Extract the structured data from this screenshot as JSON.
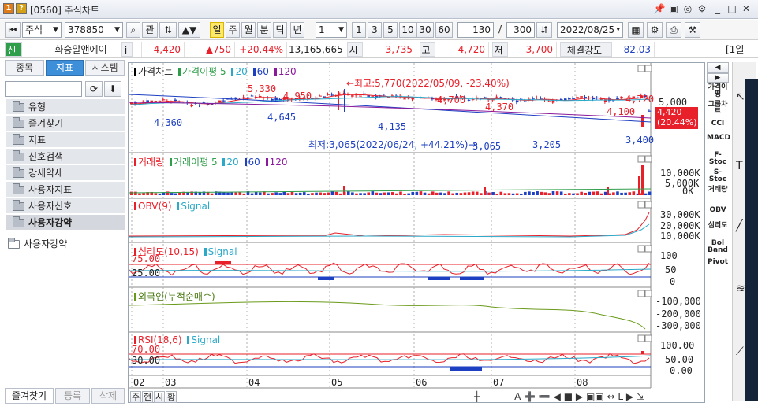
{
  "window": {
    "badge_1": "1",
    "badge_help": "?",
    "title": "[0560] 주식차트"
  },
  "toolbar": {
    "market": "주식",
    "code": "378850",
    "btn_gwan": "관",
    "periods": [
      "일",
      "주",
      "월",
      "분",
      "틱",
      "년"
    ],
    "selected_period": "일",
    "count_select": "1",
    "quick": [
      "1",
      "3",
      "5",
      "10",
      "30",
      "60"
    ],
    "view_count": "130",
    "total_count": "300",
    "date": "2022/08/25"
  },
  "quote": {
    "tag": "신",
    "info": "i",
    "name": "화승알앤에이",
    "price": "4,420",
    "change": "▲750",
    "pct": "+20.44%",
    "volume": "13,165,665",
    "open_label": "시",
    "open": "3,735",
    "high_label": "고",
    "high": "4,720",
    "low_label": "저",
    "low": "3,700",
    "strength_label": "체결강도",
    "strength": "82.03",
    "extra": "[1일"
  },
  "left": {
    "tabs": [
      "종목",
      "지표",
      "시스템"
    ],
    "selected_tab": "지표",
    "search_placeholder": "",
    "items": [
      "유형",
      "즐겨찾기",
      "지표",
      "신호검색",
      "강세약세",
      "사용자지표",
      "사용자신호",
      "사용자강약"
    ],
    "sub_item": "사용자강약",
    "bottom_tabs": [
      "즐겨찾기",
      "등록",
      "삭제"
    ]
  },
  "chart": {
    "price_title": "가격차트",
    "ma_title": "가격이평",
    "ma_periods": [
      "5",
      "20",
      "60",
      "120"
    ],
    "vol_title": "거래량",
    "vol_ma_title": "거래이평",
    "obv_title": "OBV(9)",
    "signal": "Signal",
    "psy_title": "심리도(10,15)",
    "foreign_title": "외국인(누적순매수)",
    "rsi_title": "RSI(18,6)",
    "annotations": {
      "high_note": "←최고:5,770(2022/05/09, -23.40%)",
      "low_note": "최저:3,065(2022/06/24, +44.21%)→",
      "labels": [
        "5,330",
        "4,950",
        "4,360",
        "4,645",
        "4,135",
        "4,700",
        "4,370",
        "3,065",
        "3,205",
        "4,100",
        "4,720",
        "3,400"
      ]
    },
    "price_axis": "5,000",
    "last_price": "4,420",
    "last_pct": "(20.44%)",
    "vol_axis": [
      "10,000K",
      "5,000K",
      "0K"
    ],
    "obv_axis": [
      "30,000K",
      "20,000K",
      "10,000K"
    ],
    "psy_axis": [
      "100",
      "50",
      "0"
    ],
    "psy_levels": [
      "75.00",
      "25.00"
    ],
    "foreign_axis": [
      "-100,000",
      "-200,000",
      "-300,000"
    ],
    "rsi_axis": [
      "100.00",
      "50.00",
      "0.00"
    ],
    "rsi_levels": [
      "70.00",
      "30.00"
    ],
    "months": [
      "02",
      "03",
      "04",
      "05",
      "06",
      "07",
      "08"
    ],
    "bottom_btns": [
      "주",
      "현",
      "시",
      "황"
    ]
  },
  "right_tools": [
    "가격이평",
    "그룹차트",
    "CCI",
    "MACD",
    "F-Stoc",
    "S-Stoc",
    "거래량",
    "OBV",
    "심리도",
    "Bol Band",
    "Pivot"
  ],
  "colors": {
    "up": "#e8202a",
    "down": "#1d3fc2",
    "ma5": "#e8202a",
    "ma20": "#2aa9c9",
    "ma60": "#1d3fc2",
    "ma120": "#8a1a9b",
    "accent": "#3e8fd9"
  }
}
